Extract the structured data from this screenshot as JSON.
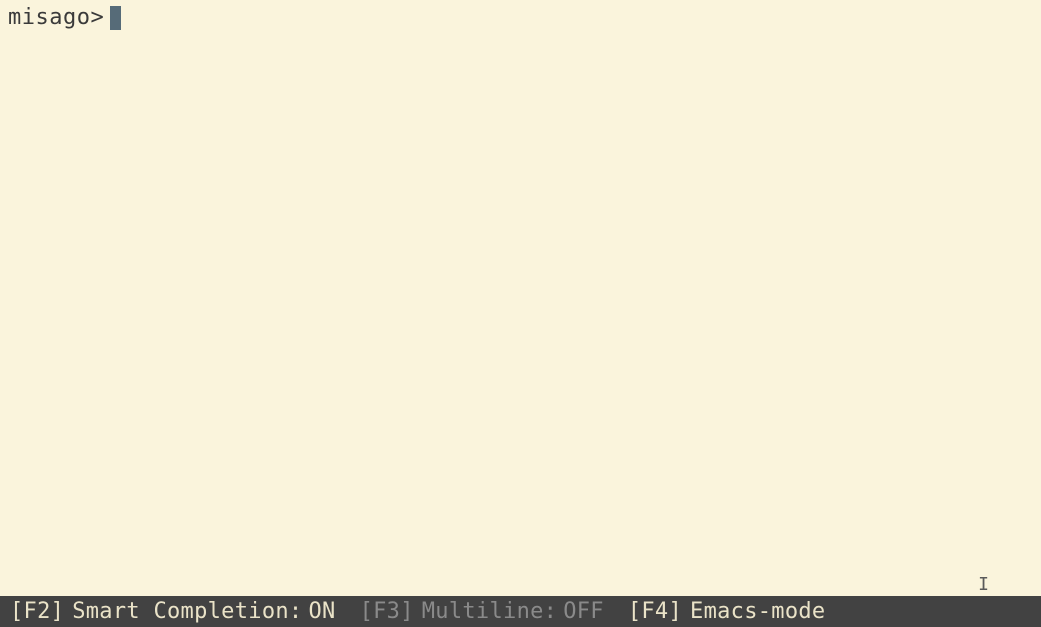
{
  "prompt": "misago>",
  "status": {
    "items": [
      {
        "key": "[F2]",
        "label": "Smart Completion:",
        "value": "ON",
        "bright": true
      },
      {
        "key": "[F3]",
        "label": "Multiline:",
        "value": "OFF",
        "bright": false
      },
      {
        "key": "[F4]",
        "label": "Emacs-mode",
        "value": "",
        "bright": true
      }
    ]
  }
}
